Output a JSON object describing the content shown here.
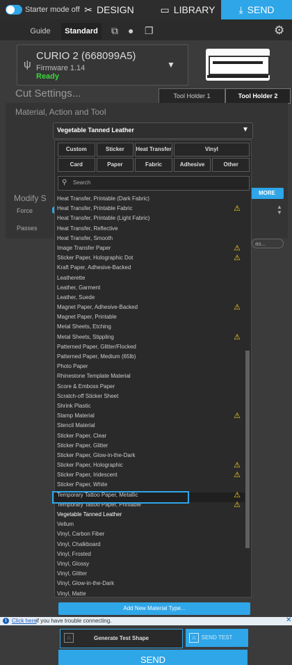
{
  "topbar": {
    "starter_mode": "Starter mode off",
    "tabs": [
      {
        "label": "DESIGN",
        "icon": "design-icon"
      },
      {
        "label": "LIBRARY",
        "icon": "library-icon"
      },
      {
        "label": "SEND",
        "icon": "send-icon"
      }
    ],
    "active_tab": "SEND",
    "accent_color": "#2ea6e8"
  },
  "subbar": {
    "guide_label": "Guide",
    "standard_label": "Standard"
  },
  "device": {
    "name": "CURIO 2 (668099A5)",
    "firmware": "Firmware 1.14",
    "status": "Ready",
    "status_color": "#3bd63b"
  },
  "cut_settings": {
    "title": "Cut Settings...",
    "tool_holder_1": "Tool Holder 1",
    "tool_holder_2": "Tool Holder 2",
    "material_section": "Material, Action and Tool",
    "modify_label": "Modify S",
    "force_label": "Force",
    "passes_label": "Passes",
    "more_label": "MORE",
    "save_as_label": "as..."
  },
  "material_dropdown": {
    "selected": "Vegetable Tanned Leather",
    "categories": [
      "Custom",
      "Sticker",
      "Heat Transfer",
      "Vinyl",
      "",
      "Card",
      "Paper",
      "Fabric",
      "Adhesive",
      "Other"
    ],
    "search_placeholder": "Search",
    "items": [
      {
        "label": "Heat Transfer, Printable (Dark Fabric)",
        "warn": false
      },
      {
        "label": "Heat Transfer, Printable Fabric",
        "warn": true
      },
      {
        "label": "Heat Transfer, Printable (Light Fabric)",
        "warn": false
      },
      {
        "label": "Heat Transfer, Reflective",
        "warn": false
      },
      {
        "label": "Heat Transfer, Smooth",
        "warn": false
      },
      {
        "label": "Image Transfer Paper",
        "warn": true
      },
      {
        "label": "Sticker Paper, Holographic Dot",
        "warn": true
      },
      {
        "label": "Kraft Paper, Adhesive-Backed",
        "warn": false
      },
      {
        "label": "Leatherette",
        "warn": false
      },
      {
        "label": "Leather, Garment",
        "warn": false
      },
      {
        "label": "Leather, Suede",
        "warn": false
      },
      {
        "label": "Magnet Paper, Adhesive-Backed",
        "warn": true
      },
      {
        "label": "Magnet Paper, Printable",
        "warn": false
      },
      {
        "label": "Metal Sheets, Etching",
        "warn": false
      },
      {
        "label": "Metal Sheets, Stippling",
        "warn": true
      },
      {
        "label": "Patterned Paper, Glitter/Flocked",
        "warn": false
      },
      {
        "label": "Patterned Paper, Medium (65lb)",
        "warn": false
      },
      {
        "label": "Photo Paper",
        "warn": false
      },
      {
        "label": "Rhinestone Template Material",
        "warn": false
      },
      {
        "label": "Score & Emboss Paper",
        "warn": false
      },
      {
        "label": "Scratch-off Sticker Sheet",
        "warn": false
      },
      {
        "label": "Shrink Plastic",
        "warn": false
      },
      {
        "label": "Stamp Material",
        "warn": true
      },
      {
        "label": "Stencil Material",
        "warn": false
      },
      {
        "label": "Sticker Paper, Clear",
        "warn": false
      },
      {
        "label": "Sticker Paper, Glitter",
        "warn": false
      },
      {
        "label": "Sticker Paper, Glow-in-the-Dark",
        "warn": false
      },
      {
        "label": "Sticker Paper, Holographic",
        "warn": true
      },
      {
        "label": "Sticker Paper, Iridescent",
        "warn": true
      },
      {
        "label": "Sticker Paper, White",
        "warn": false
      },
      {
        "label": "Temporary Tattoo Paper, Metallic",
        "warn": true
      },
      {
        "label": "Temporary Tattoo Paper, Printable",
        "warn": true
      },
      {
        "label": "Vegetable Tanned Leather",
        "warn": false,
        "selected": true
      },
      {
        "label": "Vellum",
        "warn": false
      },
      {
        "label": "Vinyl, Carbon Fiber",
        "warn": false
      },
      {
        "label": "Vinyl, Chalkboard",
        "warn": false
      },
      {
        "label": "Vinyl, Frosted",
        "warn": false
      },
      {
        "label": "Vinyl, Glossy",
        "warn": false
      },
      {
        "label": "Vinyl, Glitter",
        "warn": false
      },
      {
        "label": "Vinyl, Glow-in-the-Dark",
        "warn": false
      },
      {
        "label": "Vinyl, Matte",
        "warn": false
      }
    ],
    "add_new_label": "Add New Material Type..."
  },
  "info_bar": {
    "link_text": "Click here",
    "text": " if you have trouble connecting."
  },
  "actions": {
    "generate_test_shape": "Generate Test Shape",
    "send_test": "SEND TEST",
    "send": "SEND"
  }
}
